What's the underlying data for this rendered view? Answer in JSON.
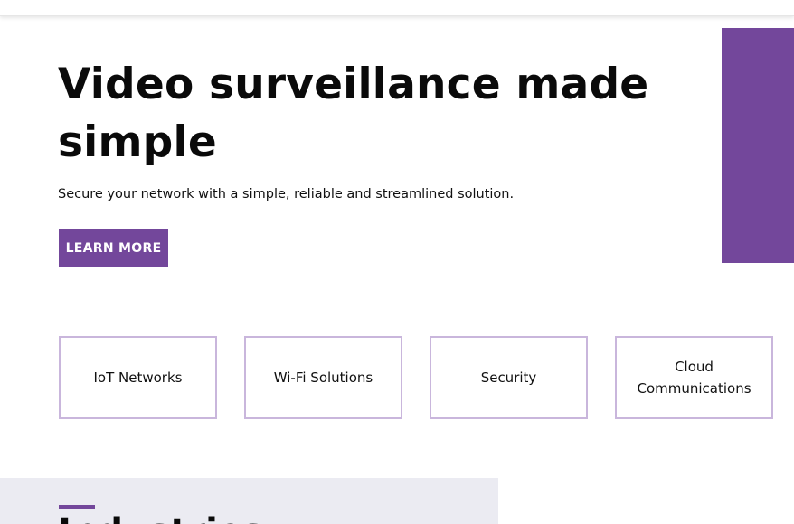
{
  "hero": {
    "title": "Video surveillance made simple",
    "subtitle": "Secure your network with a simple, reliable and streamlined solution.",
    "cta_label": "LEARN MORE"
  },
  "cards": [
    {
      "label": "IoT Networks"
    },
    {
      "label": "Wi-Fi Solutions"
    },
    {
      "label": "Security"
    },
    {
      "label": "Cloud\nCommunications"
    }
  ],
  "industries": {
    "heading": "Industries"
  },
  "colors": {
    "accent": "#73479b",
    "card_border": "#c9b6dc",
    "panel_bg": "#ebebf2"
  }
}
